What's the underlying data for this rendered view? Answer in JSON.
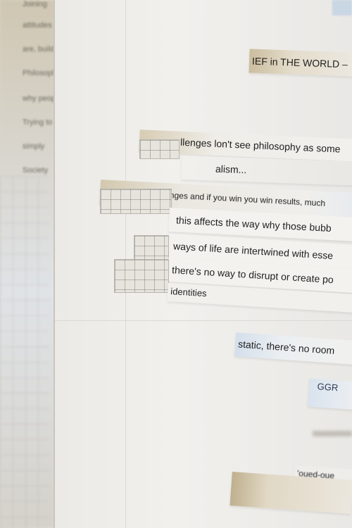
{
  "left_column": {
    "labels": [
      "Joining",
      "attitudes",
      "are, build",
      "Philosophy",
      "why peop",
      "Trying to",
      "simply",
      "Society"
    ]
  },
  "fragments": {
    "header_strip": "IEF in THE WORLD –",
    "line_1": "llenges  lon't see philosophy as some",
    "line_2": "alism...",
    "line_3": "r challenges and if you win you win results,          much",
    "line_4": "this affects the way why those bubb",
    "line_5": "ways of life are intertwined with esse",
    "line_6": "there's no way to disrupt or create po",
    "line_7": "identities",
    "line_8": "static, there's no room",
    "line_9": "GGR",
    "line_10": "'oued-oue"
  },
  "colors": {
    "paper": "#eeedea",
    "text": "#1f1f1f",
    "highlight_blue": "#cfdcec",
    "sepia": "#cdbf9f"
  }
}
